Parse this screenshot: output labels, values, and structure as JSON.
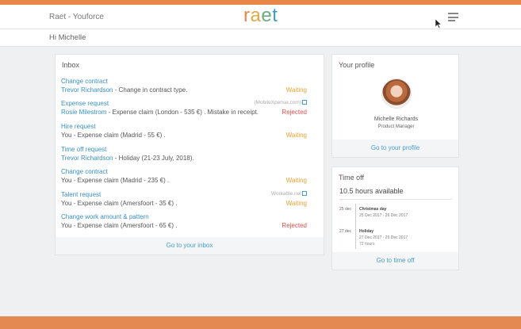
{
  "header": {
    "app_title": "Raet - Youforce",
    "logo_letters": [
      "r",
      "a",
      "e",
      "t"
    ],
    "greeting": "Hi Michelle"
  },
  "colors": {
    "accent_orange": "#e8864a",
    "link_blue": "#3a8fc0",
    "waiting": "#e3a338",
    "rejected": "#d9534f"
  },
  "inbox": {
    "title": "Inbox",
    "items": [
      {
        "title": "Change contract",
        "person": "Trevor Richardson",
        "desc": " - Change in contract type.",
        "source": "",
        "status": "Waiting",
        "status_type": "waiting"
      },
      {
        "title": "Expense request",
        "person": "Rosie Milestrom",
        "desc": " - Expense claim (London - 535 €) . Mistake in receipt.",
        "source": "(MobileXpense.com)",
        "status": "Rejected",
        "status_type": "rejected"
      },
      {
        "title": "Hire request",
        "person": "",
        "desc": "You - Expense claim (Madrid - 55 €) .",
        "source": "",
        "status": "Waiting",
        "status_type": "waiting"
      },
      {
        "title": "Time off request",
        "person": "Trevor Richardson",
        "desc": " - Holiday (21-23 July, 2018).",
        "source": "",
        "status": "",
        "status_type": ""
      },
      {
        "title": "Change contract",
        "person": "",
        "desc": "You - Expense claim (Madrid - 235 €) .",
        "source": "",
        "status": "Waiting",
        "status_type": "waiting"
      },
      {
        "title": "Talent request",
        "person": "",
        "desc": "You - Expense claim (Amersfoort - 35 €) .",
        "source": "Workable.net",
        "status": "Waiting",
        "status_type": "waiting"
      },
      {
        "title": "Change work amount & pattern",
        "person": "",
        "desc": "You - Expense claim (Amersfoort - 65 €) .",
        "source": "",
        "status": "Rejected",
        "status_type": "rejected"
      }
    ],
    "footer_link": "Go to your inbox"
  },
  "profile": {
    "title": "Your profile",
    "name": "Michelle Richards",
    "role": "Product Manager",
    "footer_link": "Go to your profile"
  },
  "timeoff": {
    "title": "Time off",
    "summary": "10.5 hours available",
    "entries": [
      {
        "date": "25 dec",
        "title": "Christmas day",
        "range": "25 Dec 2017 - 26 Dec 2017",
        "duration": ""
      },
      {
        "date": "27 dec",
        "title": "Holiday",
        "range": "27 Dec 2017 - 29 Dec 2017",
        "duration": "72 hours"
      }
    ],
    "footer_link": "Go to time off"
  }
}
